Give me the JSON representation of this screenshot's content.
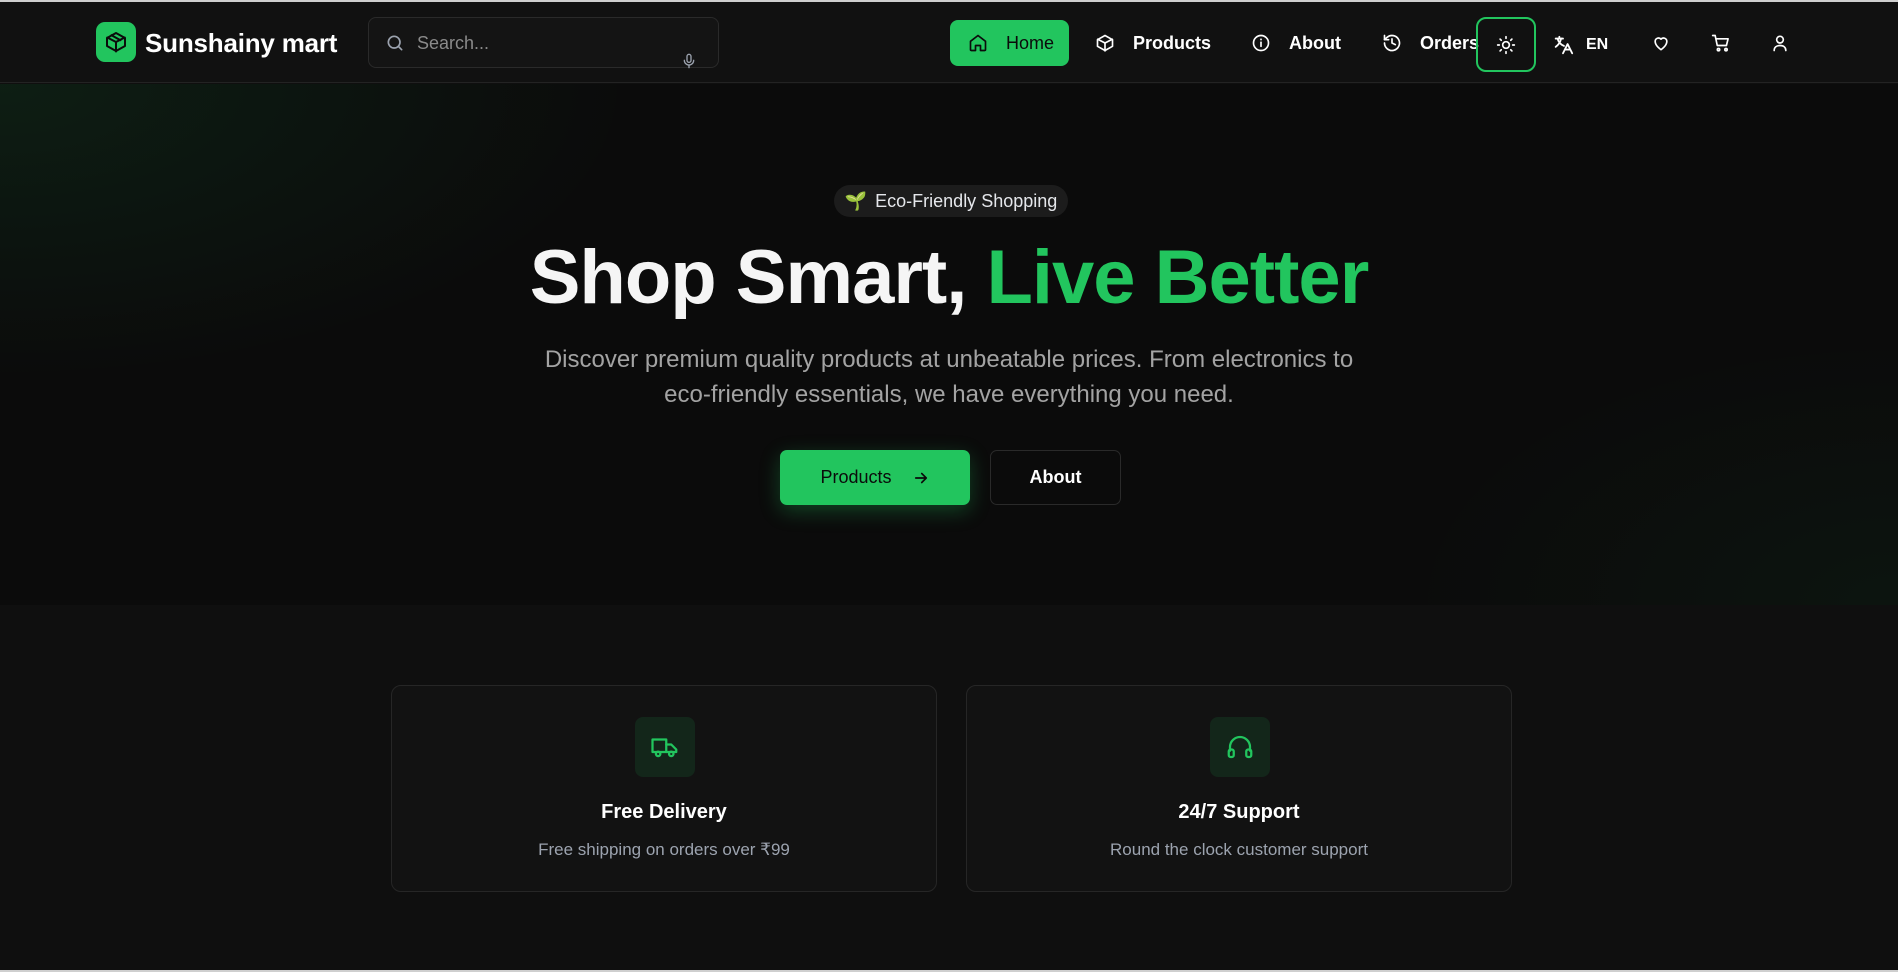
{
  "colors": {
    "accent": "#22c55e",
    "background": "#0f0f0f",
    "navbar": "#111111"
  },
  "header": {
    "brand": "Sunshainy mart",
    "logo_icon": "package-icon",
    "search": {
      "placeholder": "Search...",
      "value": "",
      "icon": "search-icon",
      "voice_icon": "mic-icon"
    },
    "nav": [
      {
        "label": "Home",
        "icon": "home-icon",
        "active": true
      },
      {
        "label": "Products",
        "icon": "package-icon",
        "active": false
      },
      {
        "label": "About",
        "icon": "info-icon",
        "active": false
      },
      {
        "label": "Orders",
        "icon": "history-icon",
        "active": false
      }
    ],
    "theme_icon": "sun-icon",
    "language": {
      "code": "EN",
      "icon": "translate-icon"
    },
    "actions": [
      "heart-icon",
      "cart-icon",
      "user-icon"
    ]
  },
  "hero": {
    "badge": {
      "emoji": "🌱",
      "text": "Eco-Friendly Shopping"
    },
    "headline_plain": "Shop Smart,",
    "headline_accent": "Live Better",
    "subtitle": "Discover premium quality products at unbeatable prices. From electronics to eco-friendly essentials, we have everything you need.",
    "primary_cta": "Products",
    "secondary_cta": "About"
  },
  "features": [
    {
      "title": "Free Delivery",
      "description": "Free shipping on orders over ₹99",
      "icon": "truck-icon"
    },
    {
      "title": "24/7 Support",
      "description": "Round the clock customer support",
      "icon": "headphones-icon"
    }
  ]
}
